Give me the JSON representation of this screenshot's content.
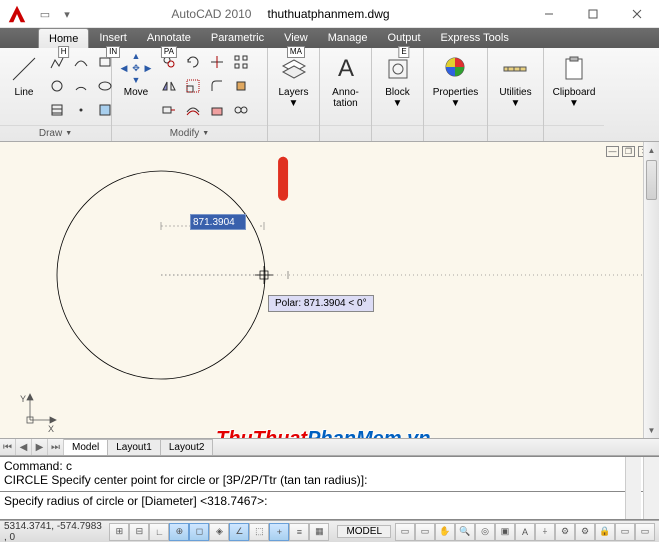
{
  "app": {
    "name": "AutoCAD 2010",
    "file": "thuthuatphanmem.dwg"
  },
  "tabs": [
    {
      "label": "Home",
      "key": "H",
      "active": true
    },
    {
      "label": "Insert",
      "key": "IN"
    },
    {
      "label": "Annotate",
      "key": "PA"
    },
    {
      "label": "Parametric",
      "key": ""
    },
    {
      "label": "View",
      "key": "MA"
    },
    {
      "label": "Manage",
      "key": ""
    },
    {
      "label": "Output",
      "key": "E"
    },
    {
      "label": "Express Tools",
      "key": ""
    }
  ],
  "ribbon": {
    "draw_panel": "Draw",
    "modify_panel": "Modify",
    "line": "Line",
    "move": "Move",
    "layers": "Layers",
    "anno": "Anno-\ntation",
    "block": "Block",
    "props": "Properties",
    "util": "Utilities",
    "clip": "Clipboard"
  },
  "canvas": {
    "input_value": "871.3904",
    "polar_tip": "Polar: 871.3904 < 0°",
    "axis_x": "X",
    "axis_y": "Y"
  },
  "layout_tabs": {
    "model": "Model",
    "l1": "Layout1",
    "l2": "Layout2"
  },
  "cmd": {
    "l1": "Command: c",
    "l2": "CIRCLE Specify center point for circle or [3P/2P/Ttr (tan tan radius)]:",
    "l3": "Specify radius of circle or [Diameter] <318.7467>:"
  },
  "status": {
    "coords": "5314.3741, -574.7983 , 0",
    "model": "MODEL"
  },
  "watermark": {
    "a": "ThuThuat",
    "b": "PhanMem",
    "c": ".vn"
  }
}
